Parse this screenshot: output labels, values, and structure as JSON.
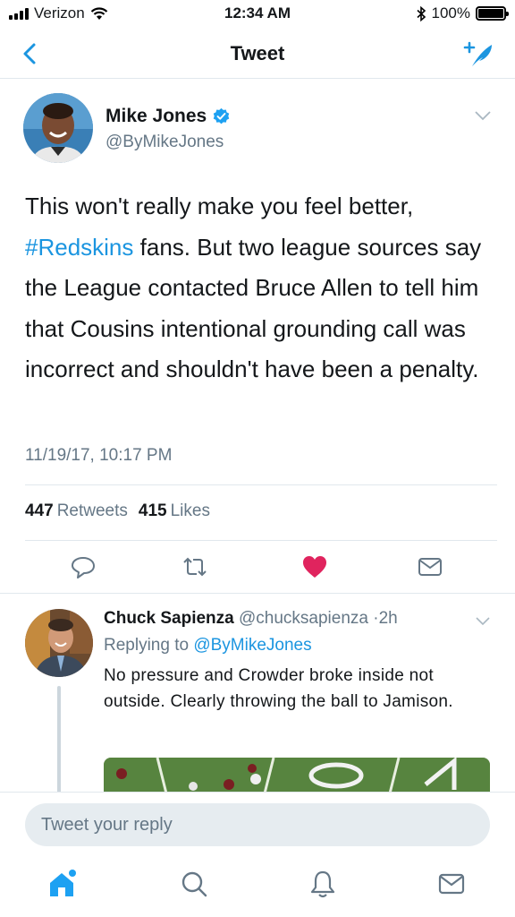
{
  "status_bar": {
    "carrier": "Verizon",
    "time": "12:34 AM",
    "battery_percent": "100%",
    "battery_level": 1.0
  },
  "nav": {
    "title": "Tweet",
    "back_icon": "chevron-left-icon",
    "compose_icon": "compose-feather-icon"
  },
  "tweet": {
    "author_name": "Mike Jones",
    "author_handle": "@ByMikeJones",
    "verified": true,
    "text_before": "This won't really make you feel better, ",
    "hashtag": "#Redskins",
    "text_after": " fans. But two league sources say the League contacted Bruce Allen to tell him that Cousins intentional grounding call was incorrect and shouldn't have been a penalty.",
    "timestamp": "11/19/17, 10:17 PM",
    "retweet_count": "447",
    "retweet_label": "Retweets",
    "like_count": "415",
    "like_label": "Likes"
  },
  "reply": {
    "author_name": "Chuck Sapienza",
    "author_handle": "@chucksapienza",
    "separator": "·",
    "age": "2h",
    "replying_prefix": "Replying to",
    "replying_handle": "@ByMikeJones",
    "text": "No pressure and Crowder broke inside not outside. Clearly throwing the ball to Jamison."
  },
  "composer": {
    "placeholder": "Tweet your reply"
  },
  "colors": {
    "accent": "#1b95e0",
    "like_active": "#e0245e",
    "muted": "#657786",
    "border": "#e1e8ed"
  }
}
